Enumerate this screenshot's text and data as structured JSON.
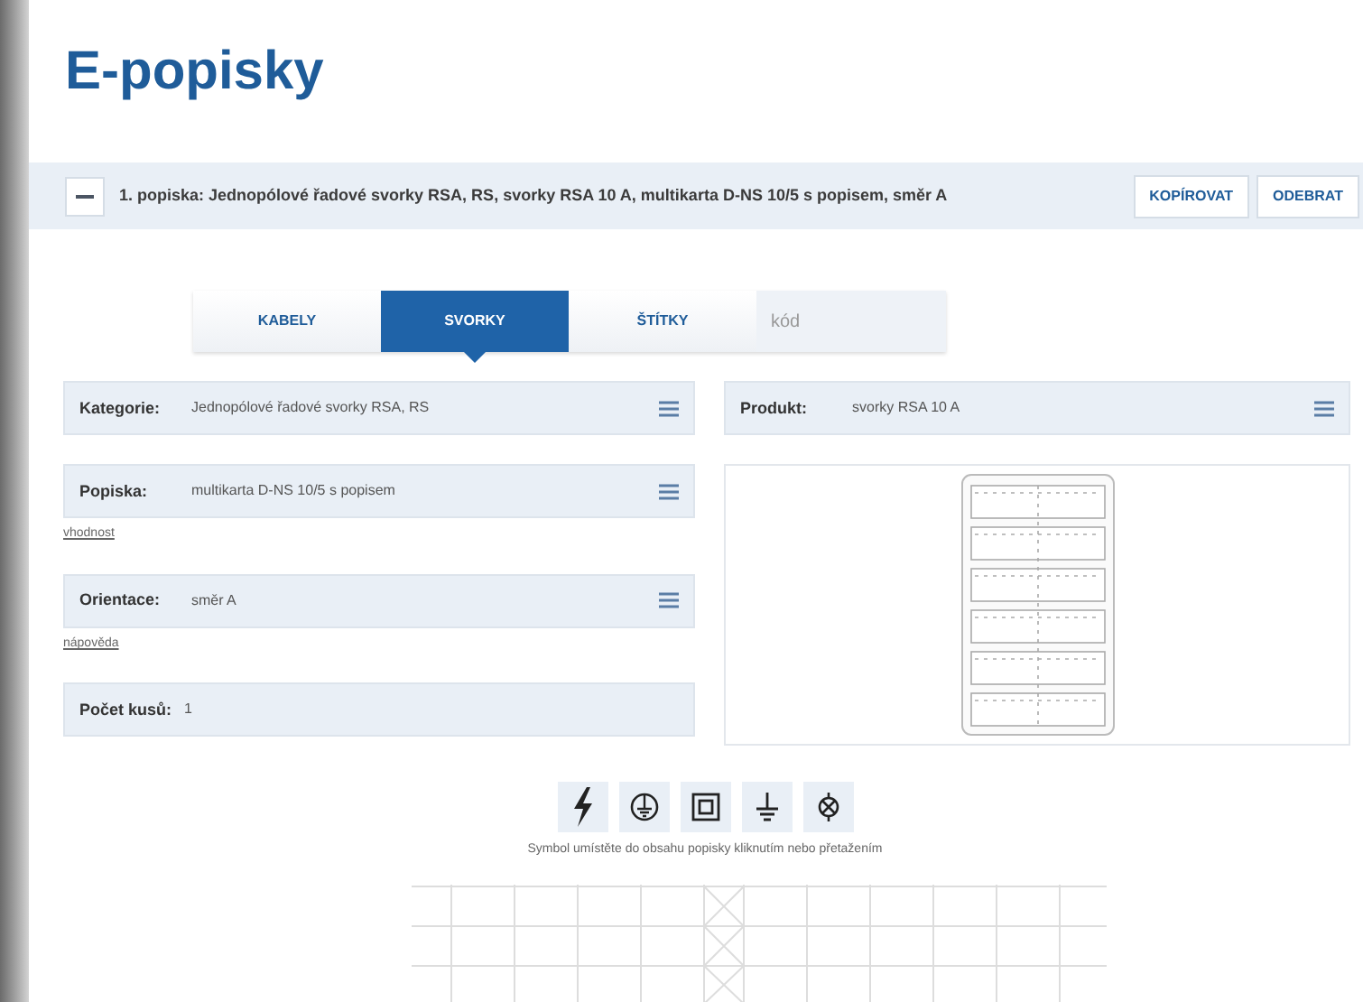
{
  "page_title": "E-popisky",
  "label_bar": {
    "title": "1. popiska: Jednopólové řadové svorky RSA, RS, svorky RSA 10 A, multikarta D-NS 10/5 s popisem, směr A",
    "buttons": [
      "KOPÍROVAT",
      "ODEBRAT"
    ]
  },
  "tabs": [
    {
      "label": "KABELY",
      "selected": false
    },
    {
      "label": "SVORKY",
      "selected": true
    },
    {
      "label": "ŠTÍTKY",
      "selected": false
    }
  ],
  "code_field": {
    "placeholder": "kód"
  },
  "fields": [
    {
      "kind": "select",
      "label": "Kategorie:",
      "value": "Jednopólové řadové svorky RSA, RS"
    },
    {
      "kind": "select",
      "label": "Popiska:",
      "value": "multikarta D-NS 10/5 s popisem",
      "link": "vhodnost"
    },
    {
      "kind": "select",
      "label": "Orientace:",
      "value": "směr A",
      "link": "nápověda"
    },
    {
      "kind": "static",
      "label": "Počet kusů:",
      "value": "1"
    }
  ],
  "product_field": {
    "kind": "select",
    "label": "Produkt:",
    "value": "svorky RSA 10 A"
  },
  "symbols": [
    {
      "kind": "bolt"
    },
    {
      "kind": "protective-earth"
    },
    {
      "kind": "double-insulation"
    },
    {
      "kind": "ground"
    },
    {
      "kind": "lamp"
    }
  ],
  "symbol_hint": "Symbol umístěte do obsahu popisky kliknutím nebo přetažením"
}
